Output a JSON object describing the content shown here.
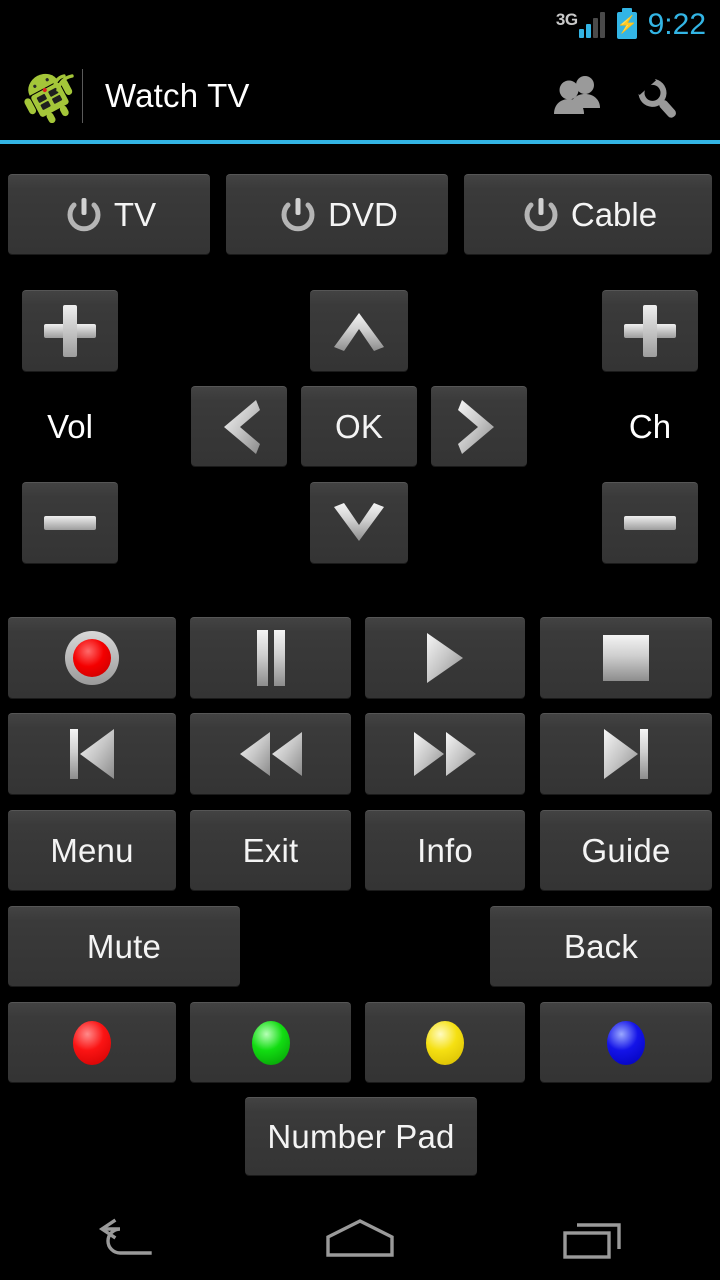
{
  "status_bar": {
    "network_type": "3G",
    "signal_bars_total": 4,
    "signal_bars_filled": 2,
    "battery_state": "charging",
    "time": "9:22",
    "accent_color": "#33b5e5"
  },
  "action_bar": {
    "app_icon": "android-remote-icon",
    "title": "Watch TV",
    "actions": [
      {
        "name": "users-icon",
        "label": "Users"
      },
      {
        "name": "wrench-icon",
        "label": "Settings"
      }
    ],
    "divider_color": "#33b5e5"
  },
  "power_row": [
    {
      "label": "TV",
      "icon": "power-icon"
    },
    {
      "label": "DVD",
      "icon": "power-icon"
    },
    {
      "label": "Cable",
      "icon": "power-icon"
    }
  ],
  "dpad": {
    "vol_label": "Vol",
    "ch_label": "Ch",
    "vol_up": "plus-icon",
    "vol_down": "minus-icon",
    "ch_up": "plus-icon",
    "ch_down": "minus-icon",
    "up": "chevron-up-icon",
    "down": "chevron-down-icon",
    "left": "chevron-left-icon",
    "right": "chevron-right-icon",
    "ok_label": "OK"
  },
  "media_row_1": [
    {
      "name": "record-button",
      "icon": "record-icon"
    },
    {
      "name": "pause-button",
      "icon": "pause-icon"
    },
    {
      "name": "play-button",
      "icon": "play-icon"
    },
    {
      "name": "stop-button",
      "icon": "stop-icon"
    }
  ],
  "media_row_2": [
    {
      "name": "previous-button",
      "icon": "skip-previous-icon"
    },
    {
      "name": "rewind-button",
      "icon": "rewind-icon"
    },
    {
      "name": "fast-forward-button",
      "icon": "fast-forward-icon"
    },
    {
      "name": "next-button",
      "icon": "skip-next-icon"
    }
  ],
  "text_row": [
    {
      "label": "Menu"
    },
    {
      "label": "Exit"
    },
    {
      "label": "Info"
    },
    {
      "label": "Guide"
    }
  ],
  "wide_row": {
    "mute_label": "Mute",
    "back_label": "Back"
  },
  "color_row": [
    {
      "name": "red-color-button",
      "color": "#f41414"
    },
    {
      "name": "green-color-button",
      "color": "#12dd12"
    },
    {
      "name": "yellow-color-button",
      "color": "#f5e012"
    },
    {
      "name": "blue-color-button",
      "color": "#1414e8"
    }
  ],
  "number_pad": {
    "label": "Number Pad"
  },
  "nav_bar": [
    {
      "name": "nav-back-icon",
      "label": "Back"
    },
    {
      "name": "nav-home-icon",
      "label": "Home"
    },
    {
      "name": "nav-recents-icon",
      "label": "Recent apps"
    }
  ]
}
